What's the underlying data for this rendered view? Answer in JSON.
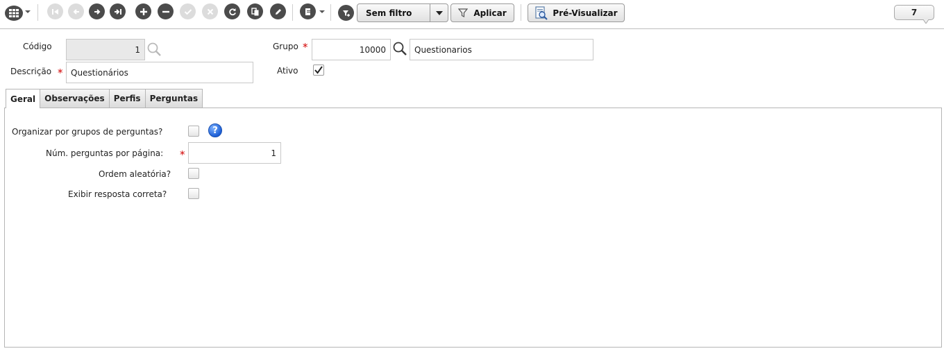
{
  "toolbar": {
    "filter_value": "Sem filtro",
    "apply_label": "Aplicar",
    "preview_label": "Pré-Visualizar",
    "record_count": "7"
  },
  "header": {
    "codigo_label": "Código",
    "codigo_value": "1",
    "grupo_label": "Grupo",
    "grupo_code": "10000",
    "grupo_name": "Questionarios",
    "descricao_label": "Descrição",
    "descricao_value": "Questionários",
    "ativo_label": "Ativo",
    "ativo_checked": true,
    "required_mark": "*"
  },
  "tabs": [
    {
      "label": "Geral",
      "active": true
    },
    {
      "label": "Observações",
      "active": false
    },
    {
      "label": "Perfis",
      "active": false
    },
    {
      "label": "Perguntas",
      "active": false
    }
  ],
  "geral": {
    "organizar_label": "Organizar por grupos de perguntas?",
    "help_glyph": "?",
    "num_perguntas_label": "Núm. perguntas por página:",
    "num_perguntas_value": "1",
    "ordem_label": "Ordem aleatória?",
    "exibir_label": "Exibir resposta correta?"
  },
  "colors": {
    "required": "#d20000",
    "help": "#1c5fd6",
    "icon_enabled": "#4b4b4b",
    "icon_disabled": "#dcdcdc"
  }
}
